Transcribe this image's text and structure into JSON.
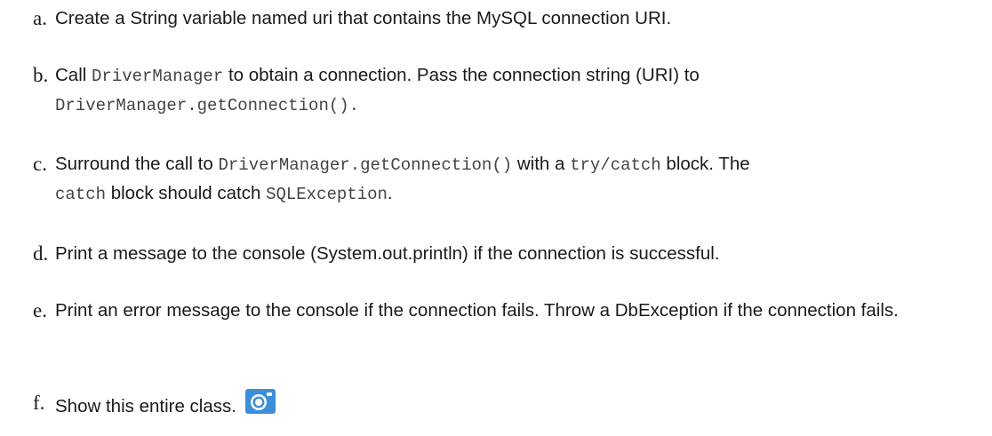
{
  "items": [
    {
      "marker": "a.",
      "segments": [
        {
          "text": "Create a String variable named uri that contains the MySQL connection URI.",
          "code": false
        }
      ]
    },
    {
      "marker": "b.",
      "segments": [
        {
          "text": "Call ",
          "code": false
        },
        {
          "text": "DriverManager",
          "code": true
        },
        {
          "text": " to obtain a connection. Pass the connection string (URI) to ",
          "code": false
        },
        {
          "text": "DriverManager.getConnection().",
          "code": true
        }
      ]
    },
    {
      "marker": "c.",
      "segments": [
        {
          "text": "Surround the call to ",
          "code": false
        },
        {
          "text": "DriverManager.getConnection()",
          "code": true
        },
        {
          "text": " with a ",
          "code": false
        },
        {
          "text": "try/catch",
          "code": true
        },
        {
          "text": " block. The ",
          "code": false
        },
        {
          "text": "catch",
          "code": true
        },
        {
          "text": " block should catch ",
          "code": false
        },
        {
          "text": "SQLException",
          "code": true
        },
        {
          "text": ".",
          "code": false
        }
      ]
    },
    {
      "marker": "d.",
      "segments": [
        {
          "text": "Print a message to the console (System.out.println) if the connection is successful.",
          "code": false
        }
      ]
    },
    {
      "marker": "e.",
      "segments": [
        {
          "text": "Print an error message to the console if the connection fails. Throw a DbException if the connection fails.",
          "code": false
        }
      ]
    },
    {
      "marker": "f.",
      "segments": [
        {
          "text": "Show this entire class.",
          "code": false
        }
      ],
      "icon": "camera-icon"
    }
  ],
  "colors": {
    "text": "#1a1a1a",
    "code": "#444444",
    "icon": "#3b8fd9"
  }
}
